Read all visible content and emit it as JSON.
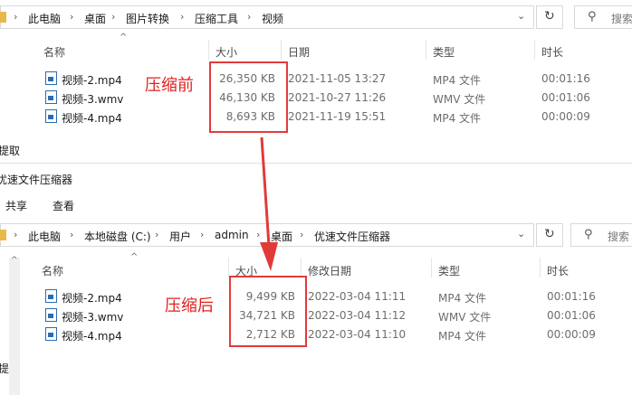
{
  "top": {
    "breadcrumb": [
      "此电脑",
      "桌面",
      "图片转换",
      "压缩工具",
      "视频"
    ],
    "search_placeholder": "搜索",
    "columns": [
      "名称",
      "大小",
      "日期",
      "类型",
      "时长"
    ],
    "files": [
      {
        "name": "视频-2.mp4",
        "size": "26,350 KB",
        "date": "2021-11-05 13:27",
        "type": "MP4 文件",
        "duration": "00:01:16"
      },
      {
        "name": "视频-3.wmv",
        "size": "46,130 KB",
        "date": "2021-10-27 11:26",
        "type": "WMV 文件",
        "duration": "00:01:06"
      },
      {
        "name": "视频-4.mp4",
        "size": "8,693 KB",
        "date": "2021-11-19 15:51",
        "type": "MP4 文件",
        "duration": "00:00:09"
      }
    ],
    "left_clip": "提取",
    "annotation": "压缩前"
  },
  "bottom": {
    "window_title": "优速文件压缩器",
    "menu": [
      "共享",
      "查看"
    ],
    "breadcrumb": [
      "此电脑",
      "本地磁盘 (C:)",
      "用户",
      "admin",
      "桌面",
      "优速文件压缩器"
    ],
    "search_placeholder": "搜索",
    "columns": [
      "名称",
      "大小",
      "修改日期",
      "类型",
      "时长"
    ],
    "files": [
      {
        "name": "视频-2.mp4",
        "size": "9,499 KB",
        "date": "2022-03-04 11:11",
        "type": "MP4 文件",
        "duration": "00:01:16"
      },
      {
        "name": "视频-3.wmv",
        "size": "34,721 KB",
        "date": "2022-03-04 11:12",
        "type": "WMV 文件",
        "duration": "00:01:06"
      },
      {
        "name": "视频-4.mp4",
        "size": "2,712 KB",
        "date": "2022-03-04 11:10",
        "type": "MP4 文件",
        "duration": "00:00:09"
      }
    ],
    "left_clip": "提",
    "annotation": "压缩后"
  },
  "colors": {
    "annotation": "#e02020",
    "highlight_box": "#e23a3a",
    "file_icon": "#2b6cb0"
  },
  "icons": [
    "folder-icon",
    "chevron-down-icon",
    "refresh-icon",
    "search-icon",
    "file-video-icon",
    "arrow-down-icon"
  ]
}
